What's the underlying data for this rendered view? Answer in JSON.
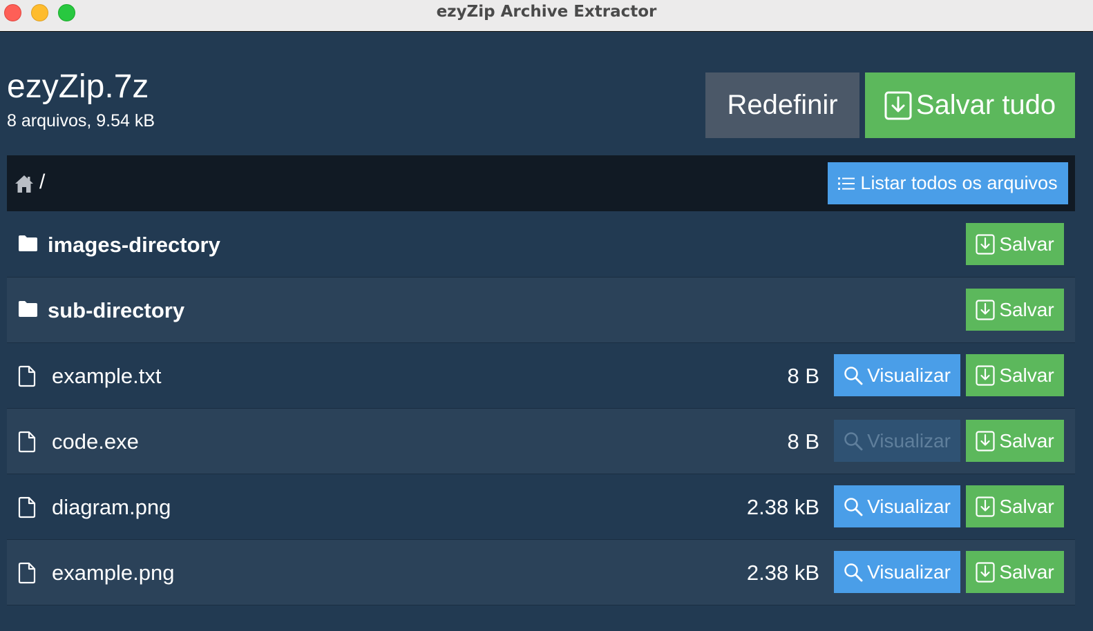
{
  "window": {
    "title": "ezyZip Archive Extractor"
  },
  "archive": {
    "name": "ezyZip.7z",
    "info": "8 arquivos, 9.54 kB"
  },
  "actions": {
    "reset_label": "Redefinir",
    "save_all_label": "Salvar tudo",
    "list_all_label": "Listar todos os arquivos"
  },
  "breadcrumb": {
    "separator": "/"
  },
  "entries": [
    {
      "type": "directory",
      "name": "images-directory",
      "size": "",
      "save_label": "Salvar"
    },
    {
      "type": "directory",
      "name": "sub-directory",
      "size": "",
      "save_label": "Salvar"
    },
    {
      "type": "file",
      "name": "example.txt",
      "size": "8 B",
      "view_label": "Visualizar",
      "view_enabled": true,
      "save_label": "Salvar"
    },
    {
      "type": "file",
      "name": "code.exe",
      "size": "8 B",
      "view_label": "Visualizar",
      "view_enabled": false,
      "save_label": "Salvar"
    },
    {
      "type": "file",
      "name": "diagram.png",
      "size": "2.38 kB",
      "view_label": "Visualizar",
      "view_enabled": true,
      "save_label": "Salvar"
    },
    {
      "type": "file",
      "name": "example.png",
      "size": "2.38 kB",
      "view_label": "Visualizar",
      "view_enabled": true,
      "save_label": "Salvar"
    }
  ],
  "colors": {
    "background": "#223a52",
    "row_alt": "#2b4259",
    "save_green": "#5cb85c",
    "view_blue": "#4a9ee8",
    "reset_gray": "#4b5868",
    "crumb_bar": "#111a24"
  },
  "icons": [
    "home-icon",
    "folder-icon",
    "file-icon",
    "download-icon",
    "search-icon",
    "list-icon"
  ]
}
